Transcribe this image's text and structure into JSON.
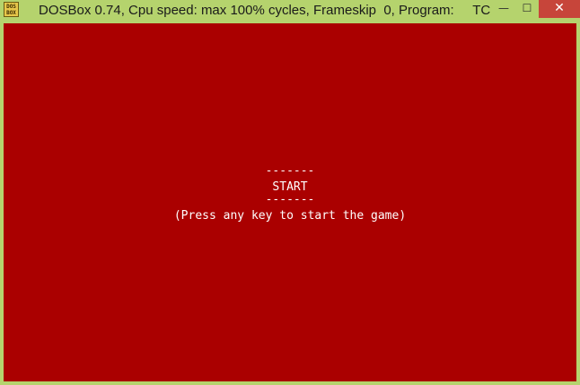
{
  "window": {
    "title": "DOSBox 0.74, Cpu speed: max 100% cycles, Frameskip  0, Program:     TC",
    "icon": "dosbox-icon",
    "icon_text": "DOS BOX",
    "buttons": {
      "minimize": "—",
      "maximize": "☐",
      "close": "✕"
    }
  },
  "screen": {
    "background": "#aa0000",
    "lines": [
      "-------",
      "START",
      "-------",
      "(Press any key to start the game)"
    ]
  }
}
